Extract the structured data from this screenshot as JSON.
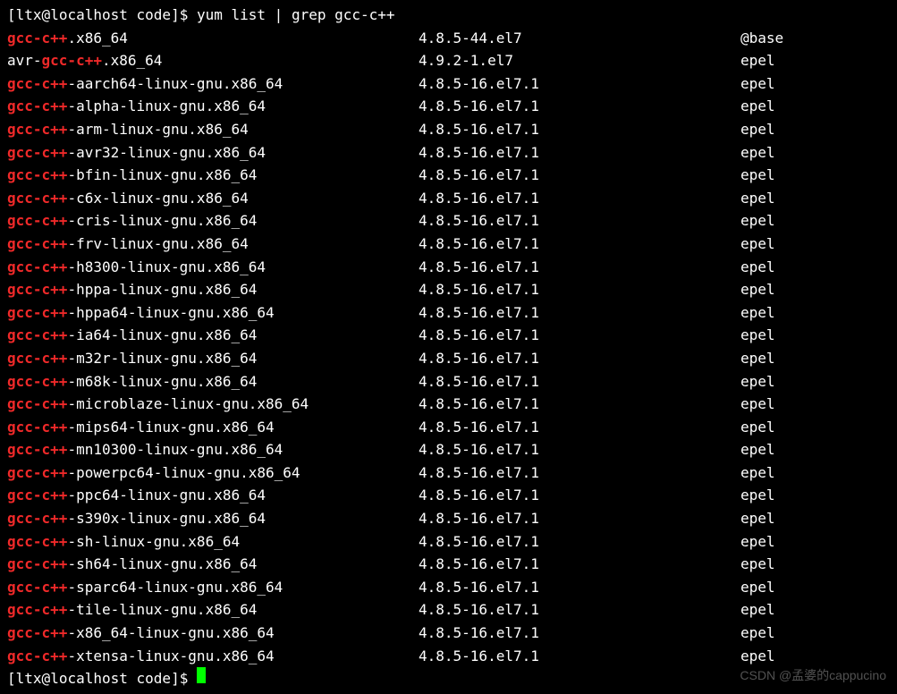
{
  "prompt": {
    "user": "ltx",
    "host": "localhost",
    "cwd": "code",
    "symbol": "$",
    "command": "yum list | grep gcc-c++"
  },
  "match": "gcc-c++",
  "rows": [
    {
      "before": "",
      "after": ".x86_64",
      "version": "4.8.5-44.el7",
      "repo": "@base"
    },
    {
      "before": "avr-",
      "after": ".x86_64",
      "version": "4.9.2-1.el7",
      "repo": "epel"
    },
    {
      "before": "",
      "after": "-aarch64-linux-gnu.x86_64",
      "version": "4.8.5-16.el7.1",
      "repo": "epel"
    },
    {
      "before": "",
      "after": "-alpha-linux-gnu.x86_64",
      "version": "4.8.5-16.el7.1",
      "repo": "epel"
    },
    {
      "before": "",
      "after": "-arm-linux-gnu.x86_64",
      "version": "4.8.5-16.el7.1",
      "repo": "epel"
    },
    {
      "before": "",
      "after": "-avr32-linux-gnu.x86_64",
      "version": "4.8.5-16.el7.1",
      "repo": "epel"
    },
    {
      "before": "",
      "after": "-bfin-linux-gnu.x86_64",
      "version": "4.8.5-16.el7.1",
      "repo": "epel"
    },
    {
      "before": "",
      "after": "-c6x-linux-gnu.x86_64",
      "version": "4.8.5-16.el7.1",
      "repo": "epel"
    },
    {
      "before": "",
      "after": "-cris-linux-gnu.x86_64",
      "version": "4.8.5-16.el7.1",
      "repo": "epel"
    },
    {
      "before": "",
      "after": "-frv-linux-gnu.x86_64",
      "version": "4.8.5-16.el7.1",
      "repo": "epel"
    },
    {
      "before": "",
      "after": "-h8300-linux-gnu.x86_64",
      "version": "4.8.5-16.el7.1",
      "repo": "epel"
    },
    {
      "before": "",
      "after": "-hppa-linux-gnu.x86_64",
      "version": "4.8.5-16.el7.1",
      "repo": "epel"
    },
    {
      "before": "",
      "after": "-hppa64-linux-gnu.x86_64",
      "version": "4.8.5-16.el7.1",
      "repo": "epel"
    },
    {
      "before": "",
      "after": "-ia64-linux-gnu.x86_64",
      "version": "4.8.5-16.el7.1",
      "repo": "epel"
    },
    {
      "before": "",
      "after": "-m32r-linux-gnu.x86_64",
      "version": "4.8.5-16.el7.1",
      "repo": "epel"
    },
    {
      "before": "",
      "after": "-m68k-linux-gnu.x86_64",
      "version": "4.8.5-16.el7.1",
      "repo": "epel"
    },
    {
      "before": "",
      "after": "-microblaze-linux-gnu.x86_64",
      "version": "4.8.5-16.el7.1",
      "repo": "epel"
    },
    {
      "before": "",
      "after": "-mips64-linux-gnu.x86_64",
      "version": "4.8.5-16.el7.1",
      "repo": "epel"
    },
    {
      "before": "",
      "after": "-mn10300-linux-gnu.x86_64",
      "version": "4.8.5-16.el7.1",
      "repo": "epel"
    },
    {
      "before": "",
      "after": "-powerpc64-linux-gnu.x86_64",
      "version": "4.8.5-16.el7.1",
      "repo": "epel"
    },
    {
      "before": "",
      "after": "-ppc64-linux-gnu.x86_64",
      "version": "4.8.5-16.el7.1",
      "repo": "epel"
    },
    {
      "before": "",
      "after": "-s390x-linux-gnu.x86_64",
      "version": "4.8.5-16.el7.1",
      "repo": "epel"
    },
    {
      "before": "",
      "after": "-sh-linux-gnu.x86_64",
      "version": "4.8.5-16.el7.1",
      "repo": "epel"
    },
    {
      "before": "",
      "after": "-sh64-linux-gnu.x86_64",
      "version": "4.8.5-16.el7.1",
      "repo": "epel"
    },
    {
      "before": "",
      "after": "-sparc64-linux-gnu.x86_64",
      "version": "4.8.5-16.el7.1",
      "repo": "epel"
    },
    {
      "before": "",
      "after": "-tile-linux-gnu.x86_64",
      "version": "4.8.5-16.el7.1",
      "repo": "epel"
    },
    {
      "before": "",
      "after": "-x86_64-linux-gnu.x86_64",
      "version": "4.8.5-16.el7.1",
      "repo": "epel"
    },
    {
      "before": "",
      "after": "-xtensa-linux-gnu.x86_64",
      "version": "4.8.5-16.el7.1",
      "repo": "epel"
    }
  ],
  "watermark": "CSDN @孟婆的cappucino"
}
